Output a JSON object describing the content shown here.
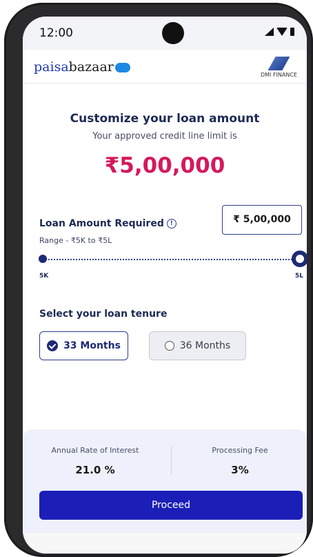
{
  "status": {
    "time": "12:00"
  },
  "header": {
    "logo_part1": "paisa",
    "logo_part2": "bazaar",
    "logo_badge": "com",
    "partner": "DMI FINANCE"
  },
  "main": {
    "title": "Customize your loan amount",
    "subtitle": "Your approved credit line limit is",
    "limit": "₹5,00,000",
    "loan_label": "Loan Amount Required",
    "range_text": "Range - ₹5K to ₹5L",
    "loan_value": "₹ 5,00,000",
    "slider": {
      "min_label": "5K",
      "max_label": "5L",
      "value_fraction": 1.0
    },
    "tenure_title": "Select your loan tenure",
    "tenure_options": [
      {
        "label": "33 Months",
        "selected": true
      },
      {
        "label": "36 Months",
        "selected": false
      }
    ]
  },
  "summary": {
    "rate_label": "Annual Rate of Interest",
    "rate_value": "21.0 %",
    "fee_label": "Processing Fee",
    "fee_value": "3%"
  },
  "actions": {
    "proceed_label": "Proceed"
  },
  "colors": {
    "accent": "#1b1fb7",
    "limit": "#d41a5b",
    "navy": "#1c2a54"
  }
}
